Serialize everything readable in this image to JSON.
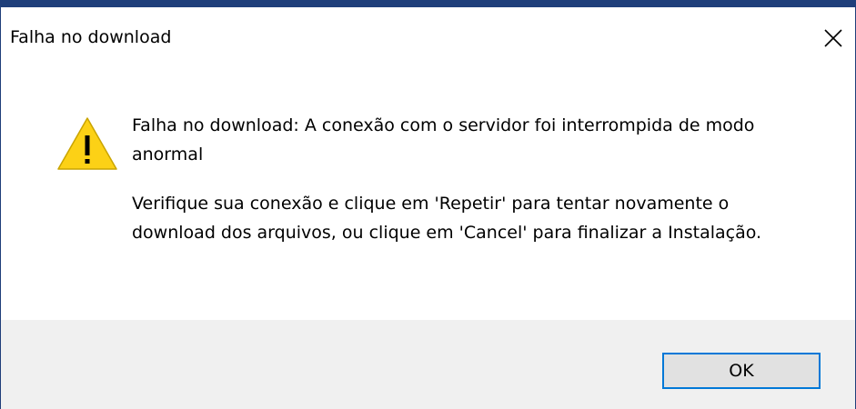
{
  "window": {
    "title": "Falha no download",
    "close_icon": "close-icon"
  },
  "message": {
    "icon": "warning-icon",
    "line1": "Falha no download: A conexão com o servidor foi interrompida de modo anormal",
    "line2": "Verifique sua conexão e clique em 'Repetir' para tentar novamente o download dos arquivos, ou clique em 'Cancel' para finalizar a Instalação."
  },
  "buttons": {
    "ok_label": "OK"
  },
  "colors": {
    "title_border": "#1f3f7a",
    "warning_fill": "#fcd116",
    "button_focus": "#0078d7",
    "footer_bg": "#f0f0f0"
  }
}
